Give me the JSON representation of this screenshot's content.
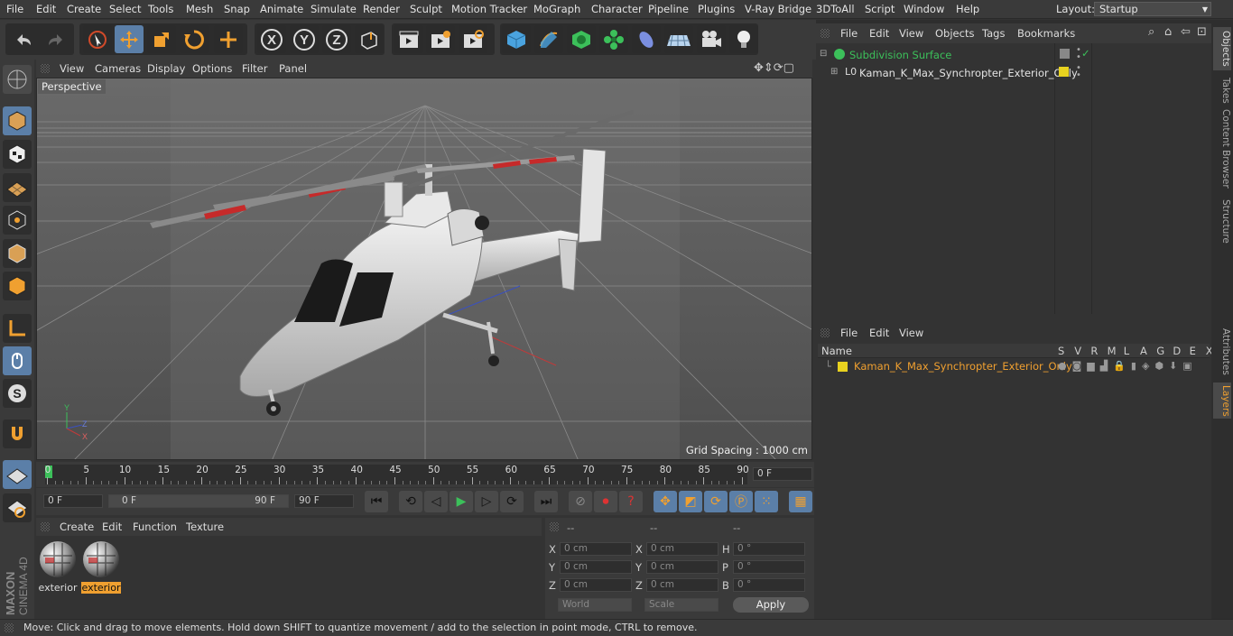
{
  "menu": [
    "File",
    "Edit",
    "Create",
    "Select",
    "Tools",
    "Mesh",
    "Snap",
    "Animate",
    "Simulate",
    "Render",
    "Sculpt",
    "Motion Tracker",
    "MoGraph",
    "Character",
    "Pipeline",
    "Plugins",
    "V-Ray Bridge",
    "3DToAll",
    "Script",
    "Window",
    "Help"
  ],
  "layout": {
    "label": "Layout:",
    "value": "Startup"
  },
  "viewport": {
    "menu": [
      "View",
      "Cameras",
      "Display",
      "Options",
      "Filter",
      "Panel"
    ],
    "camera_label": "Perspective",
    "grid_spacing": "Grid Spacing : 1000 cm"
  },
  "timeline": {
    "ticks": [
      "0",
      "5",
      "10",
      "15",
      "20",
      "25",
      "30",
      "35",
      "40",
      "45",
      "50",
      "55",
      "60",
      "65",
      "70",
      "75",
      "80",
      "85",
      "90"
    ],
    "current_frame": "0 F"
  },
  "transport": {
    "start_field": "0 F",
    "range_start": "0 F",
    "range_end": "90 F",
    "end_field": "90 F"
  },
  "materials": {
    "menu": [
      "Create",
      "Edit",
      "Function",
      "Texture"
    ],
    "items": [
      {
        "label": "exterior",
        "selected": false
      },
      {
        "label": "exterior",
        "selected": true
      }
    ]
  },
  "coords": {
    "headers": [
      "--",
      "--",
      "--"
    ],
    "rows": [
      {
        "a": "X",
        "av": "0 cm",
        "b": "X",
        "bv": "0 cm",
        "c": "H",
        "cv": "0 °"
      },
      {
        "a": "Y",
        "av": "0 cm",
        "b": "Y",
        "bv": "0 cm",
        "c": "P",
        "cv": "0 °"
      },
      {
        "a": "Z",
        "av": "0 cm",
        "b": "Z",
        "bv": "0 cm",
        "c": "B",
        "cv": "0 °"
      }
    ],
    "mode": "World",
    "scale": "Scale",
    "apply": "Apply"
  },
  "objects": {
    "menu": [
      "File",
      "Edit",
      "View",
      "Objects",
      "Tags",
      "Bookmarks"
    ],
    "items": [
      {
        "name": "Subdivision Surface"
      },
      {
        "name": "Kaman_K_Max_Synchropter_Exterior_Only"
      }
    ]
  },
  "layers": {
    "menu": [
      "File",
      "Edit",
      "View"
    ],
    "columns": {
      "name": "Name",
      "flags": [
        "S",
        "V",
        "R",
        "M",
        "L",
        "A",
        "G",
        "D",
        "E",
        "X"
      ]
    },
    "rows": [
      {
        "name": "Kaman_K_Max_Synchropter_Exterior_Only",
        "color": "#e8d21f"
      }
    ]
  },
  "right_tabs": [
    "Objects",
    "Takes",
    "Content Browser",
    "Structure",
    "Attributes",
    "Layers"
  ],
  "status": "Move: Click and drag to move elements. Hold down SHIFT to quantize movement / add to the selection in point mode, CTRL to remove.",
  "brand": {
    "line1": "MAXON",
    "line2": "CINEMA 4D"
  },
  "colors": {
    "accent": "#5b7fa8",
    "highlight": "#f0a030",
    "layer_yellow": "#e8d21f"
  }
}
